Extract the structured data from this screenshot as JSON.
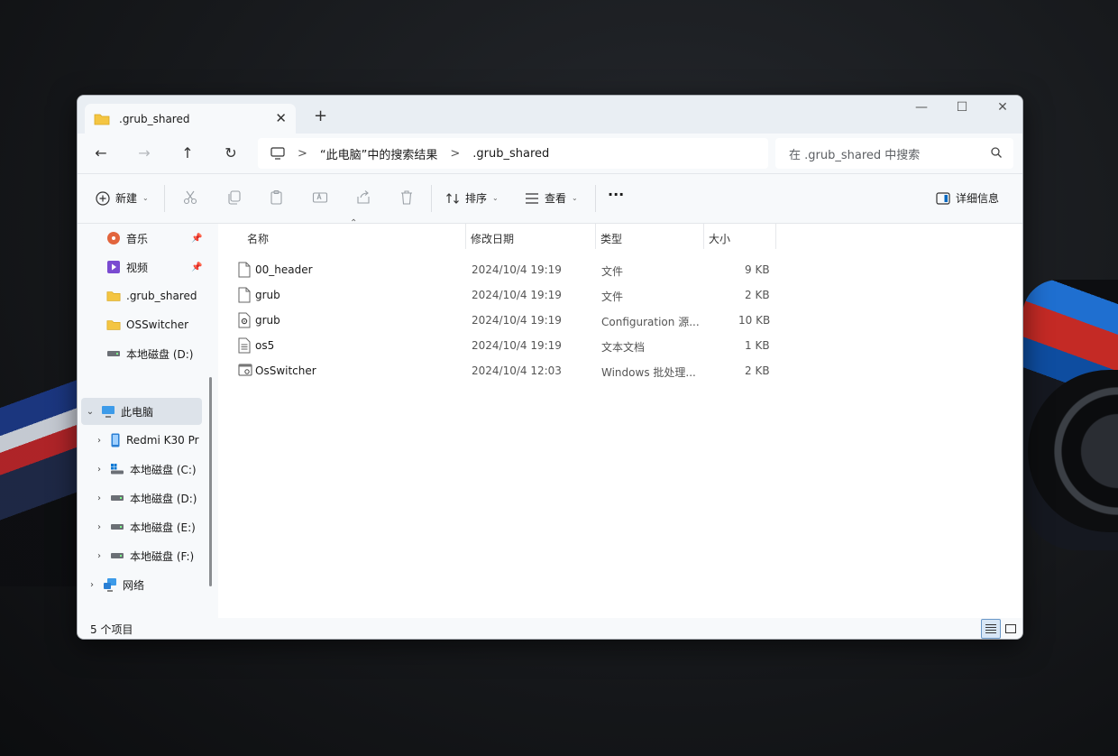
{
  "tab": {
    "title": ".grub_shared",
    "close": "✕",
    "new": "+"
  },
  "window_controls": {
    "minimize": "—",
    "maximize": "☐",
    "close": "✕"
  },
  "address": {
    "back": "←",
    "forward": "→",
    "up": "↑",
    "refresh": "↻",
    "crumbs": [
      "“此电脑”中的搜索结果",
      ".grub_shared"
    ],
    "separator": ">",
    "search_placeholder": "在 .grub_shared 中搜索"
  },
  "toolbar": {
    "new_label": "新建",
    "sort_label": "排序",
    "view_label": "查看",
    "more_label": "···",
    "details_label": "详细信息"
  },
  "nav": {
    "quick": [
      {
        "label": "音乐",
        "icon": "music-icon",
        "pinned": true
      },
      {
        "label": "视频",
        "icon": "video-icon",
        "pinned": true
      },
      {
        "label": ".grub_shared",
        "icon": "folder-icon",
        "pinned": false
      },
      {
        "label": "OSSwitcher",
        "icon": "folder-icon",
        "pinned": false
      },
      {
        "label": "本地磁盘 (D:)",
        "icon": "drive-icon",
        "pinned": false
      }
    ],
    "this_pc": "此电脑",
    "children": [
      {
        "label": "Redmi K30 Pr",
        "icon": "phone-icon"
      },
      {
        "label": "本地磁盘 (C:)",
        "icon": "windows-drive-icon"
      },
      {
        "label": "本地磁盘 (D:)",
        "icon": "drive-icon"
      },
      {
        "label": "本地磁盘 (E:)",
        "icon": "drive-icon"
      },
      {
        "label": "本地磁盘 (F:)",
        "icon": "drive-icon"
      }
    ],
    "network": "网络"
  },
  "columns": {
    "name": "名称",
    "date": "修改日期",
    "type": "类型",
    "size": "大小"
  },
  "files": [
    {
      "name": "00_header",
      "date": "2024/10/4 19:19",
      "type": "文件",
      "size": "9 KB",
      "icon": "file-icon"
    },
    {
      "name": "grub",
      "date": "2024/10/4 19:19",
      "type": "文件",
      "size": "2 KB",
      "icon": "file-icon"
    },
    {
      "name": "grub",
      "date": "2024/10/4 19:19",
      "type": "Configuration 源...",
      "size": "10 KB",
      "icon": "config-file-icon"
    },
    {
      "name": "os5",
      "date": "2024/10/4 19:19",
      "type": "文本文档",
      "size": "1 KB",
      "icon": "text-file-icon"
    },
    {
      "name": "OsSwitcher",
      "date": "2024/10/4 12:03",
      "type": "Windows 批处理...",
      "size": "2 KB",
      "icon": "batch-file-icon"
    }
  ],
  "status": {
    "count": "5 个项目"
  },
  "colors": {
    "accent": "#0067c0",
    "folder": "#f4c542",
    "selected_nav": "#dde3ea"
  }
}
